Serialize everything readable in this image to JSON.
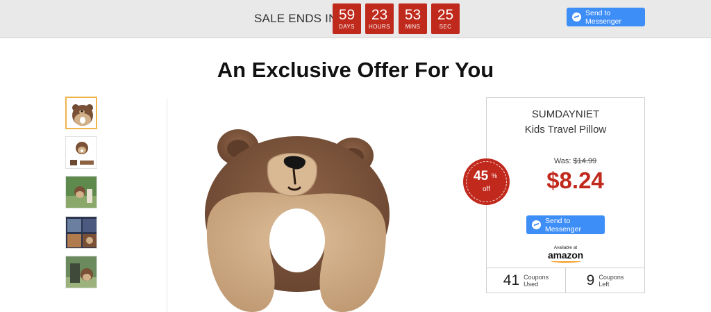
{
  "topbar": {
    "sale_label": "SALE ENDS IN",
    "timers": [
      {
        "value": "59",
        "unit": "DAYS"
      },
      {
        "value": "23",
        "unit": "HOURS"
      },
      {
        "value": "53",
        "unit": "MINS"
      },
      {
        "value": "25",
        "unit": "SEC"
      }
    ],
    "messenger_label": "Send to Messenger"
  },
  "heading": "An Exclusive Offer For You",
  "product": {
    "brand": "SUMDAYNIET",
    "name": "Kids Travel Pillow",
    "was_label": "Was:",
    "was_price": "$14.99",
    "price": "$8.24",
    "discount_value": "45",
    "discount_symbol": "%",
    "discount_off": "off",
    "messenger_label": "Send to Messenger",
    "available_at": "Available at",
    "store_name": "amazon"
  },
  "stats": {
    "used_count": "41",
    "used_label_1": "Coupons",
    "used_label_2": "Used",
    "left_count": "9",
    "left_label_1": "Coupons",
    "left_label_2": "Left"
  },
  "colors": {
    "accent_red": "#c1291d",
    "messenger_blue": "#3e8ef7",
    "thumb_active": "#f0b44a"
  }
}
